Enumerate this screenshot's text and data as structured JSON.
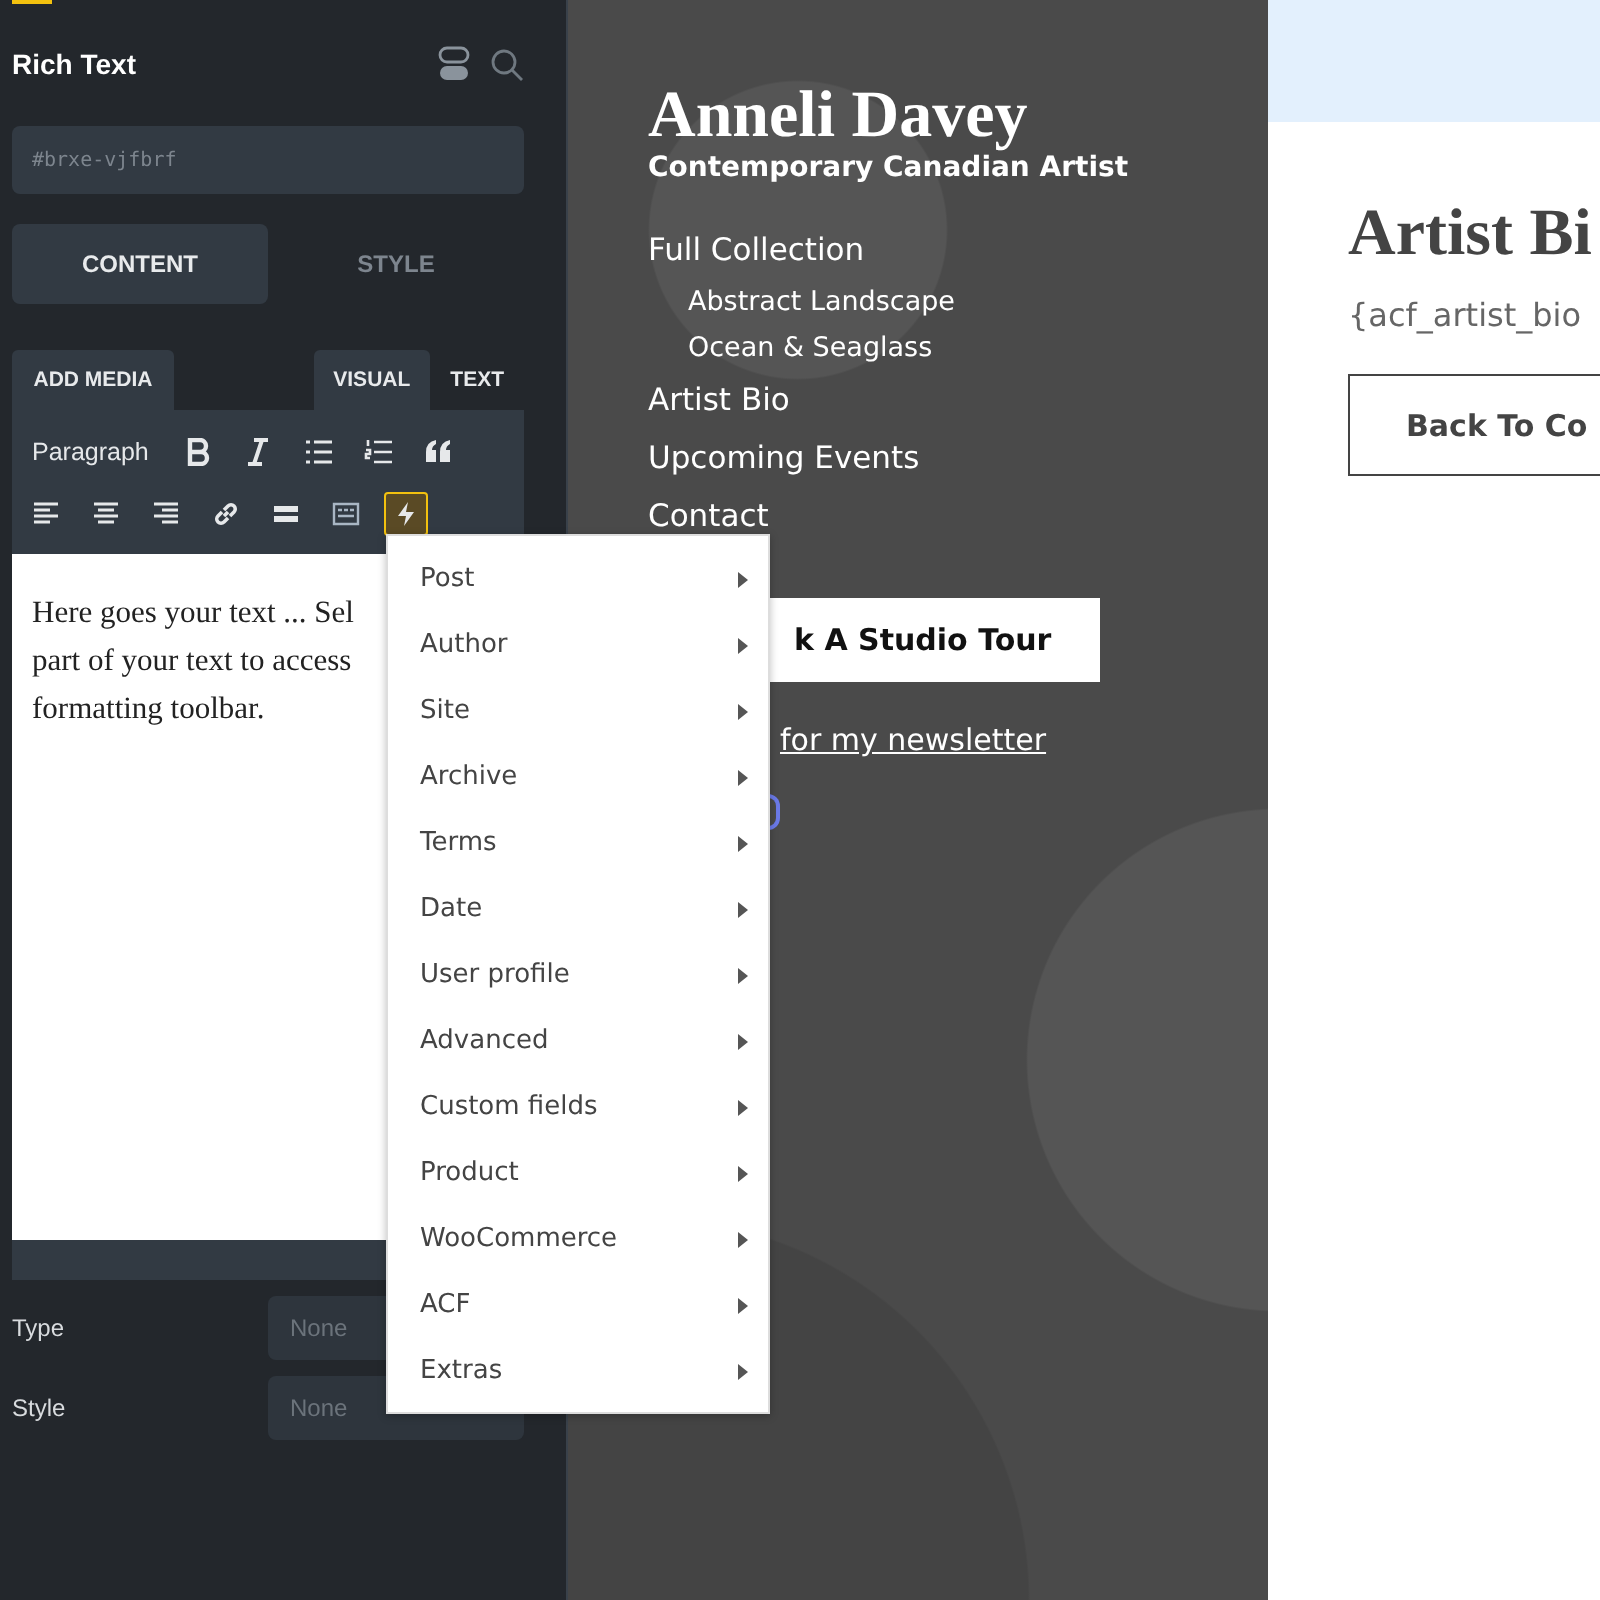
{
  "panel": {
    "title": "Rich Text",
    "id_field": {
      "placeholder": "#brxe-vjfbrf"
    },
    "tabs": [
      {
        "label": "CONTENT",
        "selected": true
      },
      {
        "label": "STYLE",
        "selected": false
      }
    ],
    "editor": {
      "add_media": "ADD MEDIA",
      "modes": [
        {
          "label": "VISUAL",
          "selected": true
        },
        {
          "label": "TEXT",
          "selected": false
        }
      ],
      "format": "Paragraph",
      "tools": [
        {
          "kind": "bold",
          "active": false
        },
        {
          "kind": "italic",
          "active": false
        },
        {
          "kind": "bullets",
          "active": false
        },
        {
          "kind": "numbers",
          "active": false
        },
        {
          "kind": "quote",
          "active": false
        },
        {
          "kind": "align-left",
          "active": false
        },
        {
          "kind": "align-center",
          "active": false
        },
        {
          "kind": "align-right",
          "active": false
        },
        {
          "kind": "link",
          "active": false
        },
        {
          "kind": "more",
          "active": false
        },
        {
          "kind": "toolbar",
          "active": false
        },
        {
          "kind": "dynamic",
          "active": true
        }
      ],
      "lines": [
        "Here goes your text ... Sel",
        "part of your text to access",
        "formatting toolbar."
      ]
    },
    "fields": [
      {
        "label": "Type",
        "value": "None"
      },
      {
        "label": "Style",
        "value": "None"
      }
    ]
  },
  "menu": {
    "items": [
      "Post",
      "Author",
      "Site",
      "Archive",
      "Terms",
      "Date",
      "User profile",
      "Advanced",
      "Custom fields",
      "Product",
      "WooCommerce",
      "ACF",
      "Extras"
    ]
  },
  "preview": {
    "name": "Anneli Davey",
    "tagline": "Contemporary Canadian Artist",
    "nav": [
      {
        "label": "Full Collection",
        "children": [
          {
            "label": "Abstract Landscape"
          },
          {
            "label": "Ocean & Seaglass"
          }
        ]
      },
      {
        "label": "Artist Bio"
      },
      {
        "label": "Upcoming Events"
      },
      {
        "label": "Contact"
      }
    ],
    "tour_button": "k A Studio Tour",
    "newsletter_link": "for my newsletter"
  },
  "page": {
    "heading": "Artist Bi",
    "body": "{acf_artist_bio",
    "back_button": "Back To Co"
  }
}
